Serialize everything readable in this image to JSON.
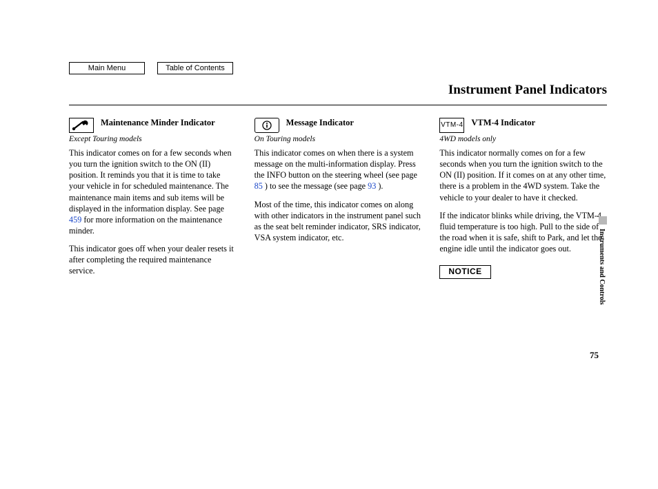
{
  "nav": {
    "main_menu": "Main Menu",
    "toc": "Table of Contents"
  },
  "page_title": "Instrument Panel Indicators",
  "side_tab": "Instruments and Controls",
  "page_number": "75",
  "col1": {
    "icon": "wrench-icon",
    "title": "Maintenance Minder Indicator",
    "subtitle": "Except Touring models",
    "p1a": "This indicator comes on for a few seconds when you turn the ignition switch to the ON (II) position. It reminds you that it is time to take your vehicle in for scheduled maintenance. The maintenance main items and sub items will be displayed in the information display. See page ",
    "p1_link": "459",
    "p1b": " for more information on the maintenance minder.",
    "p2": "This indicator goes off when your dealer resets it after completing the required maintenance service."
  },
  "col2": {
    "icon": "info-icon",
    "title": "Message Indicator",
    "subtitle": "On Touring models",
    "p1a": "This indicator comes on when there is a system message on the multi-information display. Press the INFO button on the steering wheel (see page ",
    "p1_link1": "85",
    "p1b": " ) to see the message (see page ",
    "p1_link2": "93",
    "p1c": " ).",
    "p2": "Most of the time, this indicator comes on along with other indicators in the instrument panel such as the seat belt reminder indicator, SRS indicator, VSA system indicator, etc."
  },
  "col3": {
    "icon_label": "VTM-4",
    "title": "VTM-4 Indicator",
    "subtitle": "4WD models only",
    "p1": "This indicator normally comes on for a few seconds when you turn the ignition switch to the ON (II) position. If it comes on at any other time, there is a problem in the 4WD system. Take the vehicle to your dealer to have it checked.",
    "p2": "If the indicator blinks while driving, the VTM-4 fluid temperature is too high. Pull to the side of the road when it is safe, shift to Park, and let the engine idle until the indicator goes out.",
    "notice": "NOTICE"
  }
}
